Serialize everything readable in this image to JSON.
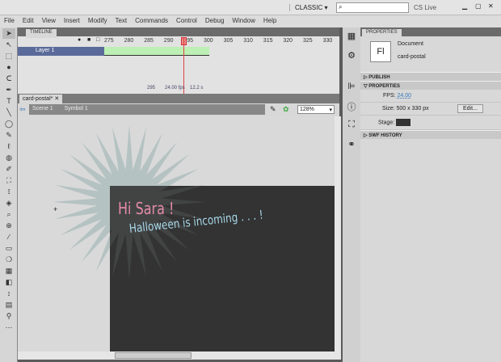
{
  "titlebar": {
    "workspace": "CLASSIC ▾",
    "search_placeholder": "",
    "cslive": "CS Live"
  },
  "menu": [
    "File",
    "Edit",
    "View",
    "Insert",
    "Modify",
    "Text",
    "Commands",
    "Control",
    "Debug",
    "Window",
    "Help"
  ],
  "tools": [
    "➤",
    "↖",
    "⬚",
    "●",
    "ᑕ",
    "✒",
    "T",
    "╲",
    "◯",
    "✎",
    "ℓ",
    "◍",
    "✐",
    "⛶",
    "⟟",
    "◈",
    "⌕",
    "⊕",
    "∕",
    "▭",
    "❍",
    "▦",
    "◧",
    "↕",
    "▤",
    "⚲",
    "⋯"
  ],
  "timeline": {
    "tab": "TIMELINE",
    "frames": [
      "275",
      "280",
      "285",
      "290",
      "295",
      "300",
      "305",
      "310",
      "315",
      "320",
      "325",
      "330"
    ],
    "layer": "Layer 1",
    "current_frame": "295",
    "fps": "24.00 fps",
    "time": "12.2 s"
  },
  "document": {
    "tab": "card-postal*",
    "scene": "Scene 1",
    "symbol": "Symbol 1",
    "zoom": "128%"
  },
  "stage": {
    "line1": "Hi Sara !",
    "line2": "Halloween is incoming . . . !",
    "line1_color": "#e48aa8",
    "line2_color": "#a8d8ea",
    "backdrop": "#333333",
    "burst": "#b6c2c2"
  },
  "properties": {
    "tab": "PROPERTIES",
    "icon": "Fl",
    "type": "Document",
    "name": "card-postal",
    "publish": "PUBLISH",
    "section": "PROPERTIES",
    "fps_label": "FPS:",
    "fps": "24.00",
    "size_label": "Size:",
    "size": "500 x 330 px",
    "edit": "Edit...",
    "stage_label": "Stage:",
    "swf": "SWF HISTORY"
  }
}
